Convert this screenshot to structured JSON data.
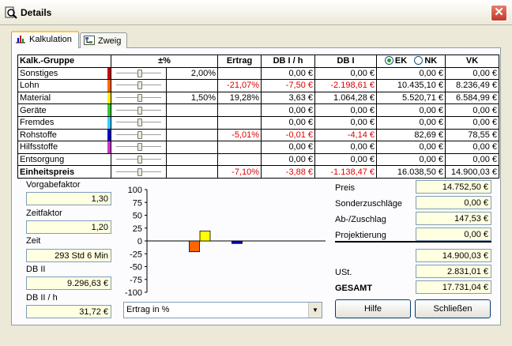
{
  "window": {
    "title": "Details",
    "close_glyph": "✕"
  },
  "tabs": [
    {
      "label": "Kalkulation",
      "icon": "chart-icon",
      "active": true
    },
    {
      "label": "Zweig",
      "icon": "tree-icon",
      "active": false
    }
  ],
  "table": {
    "headers": {
      "group": "Kalk.-Gruppe",
      "pct": "±%",
      "ertrag": "Ertrag",
      "db1h": "DB I / h",
      "db1": "DB I",
      "ek": "EK",
      "nk": "NK",
      "vk": "VK"
    },
    "price_mode_selected": "EK",
    "rows": [
      {
        "name": "Sonstiges",
        "color": "#CC0000",
        "pct": "2,00%",
        "ertrag": "",
        "db1h": "0,00 €",
        "db1": "0,00 €",
        "ek": "0,00 €",
        "vk": "0,00 €",
        "neg": false
      },
      {
        "name": "Lohn",
        "color": "#FF6600",
        "pct": "",
        "ertrag": "-21,07%",
        "db1h": "-7,50 €",
        "db1": "-2.198,61 €",
        "ek": "10.435,10 €",
        "vk": "8.236,49 €",
        "neg": true
      },
      {
        "name": "Material",
        "color": "#FFEE00",
        "pct": "1,50%",
        "ertrag": "19,28%",
        "db1h": "3,63 €",
        "db1": "1.064,28 €",
        "ek": "5.520,71 €",
        "vk": "6.584,99 €",
        "neg": false
      },
      {
        "name": "Geräte",
        "color": "#33CC33",
        "pct": "",
        "ertrag": "",
        "db1h": "0,00 €",
        "db1": "0,00 €",
        "ek": "0,00 €",
        "vk": "0,00 €",
        "neg": false
      },
      {
        "name": "Fremdes",
        "color": "#33CCFF",
        "pct": "",
        "ertrag": "",
        "db1h": "0,00 €",
        "db1": "0,00 €",
        "ek": "0,00 €",
        "vk": "0,00 €",
        "neg": false
      },
      {
        "name": "Rohstoffe",
        "color": "#0000CC",
        "pct": "",
        "ertrag": "-5,01%",
        "db1h": "-0,01 €",
        "db1": "-4,14 €",
        "ek": "82,69 €",
        "vk": "78,55 €",
        "neg": true
      },
      {
        "name": "Hilfsstoffe",
        "color": "#CC33CC",
        "pct": "",
        "ertrag": "",
        "db1h": "0,00 €",
        "db1": "0,00 €",
        "ek": "0,00 €",
        "vk": "0,00 €",
        "neg": false
      },
      {
        "name": "Entsorgung",
        "color": "#FFFFFF",
        "pct": "",
        "ertrag": "",
        "db1h": "0,00 €",
        "db1": "0,00 €",
        "ek": "0,00 €",
        "vk": "0,00 €",
        "neg": false
      },
      {
        "name": "Einheitspreis",
        "color": "#FFFFFF",
        "pct": "",
        "ertrag": "-7,10%",
        "db1h": "-3,88 €",
        "db1": "-1.138,47 €",
        "ek": "16.038,50 €",
        "vk": "14.900,03 €",
        "neg": true,
        "bold": true
      }
    ]
  },
  "left_fields": {
    "vorgabefaktor": {
      "label": "Vorgabefaktor",
      "value": "1,30"
    },
    "zeitfaktor": {
      "label": "Zeitfaktor",
      "value": "1,20"
    },
    "zeit": {
      "label": "Zeit",
      "value": "293 Std 6 Min"
    },
    "db2": {
      "label": "DB II",
      "value": "9.296,63 €"
    },
    "db2h": {
      "label": "DB II / h",
      "value": "31,72 €"
    }
  },
  "chart_data": {
    "type": "bar",
    "title": "",
    "xlabel": "",
    "ylabel": "",
    "ylim": [
      -100,
      100
    ],
    "yticks": [
      100,
      75,
      50,
      25,
      0,
      -25,
      -50,
      -75,
      -100
    ],
    "categories": [
      "Sonstiges",
      "Lohn",
      "Material",
      "Geräte",
      "Fremdes",
      "Rohstoffe",
      "Hilfsstoffe",
      "Entsorgung"
    ],
    "values": [
      0,
      -21.07,
      19.28,
      0,
      0,
      -5.01,
      0,
      0
    ],
    "colors": [
      "#CC0000",
      "#FF6600",
      "#FFFF00",
      "#33CC33",
      "#33CCFF",
      "#0000CC",
      "#CC33CC",
      "#FFFFFF"
    ],
    "grid": false
  },
  "chart_select": {
    "value": "Ertrag in %"
  },
  "summary": {
    "preis": {
      "label": "Preis",
      "value": "14.752,50 €"
    },
    "sonder": {
      "label": "Sonderzuschläge",
      "value": "0,00 €"
    },
    "abzu": {
      "label": "Ab-/Zuschlag",
      "value": "147,53 €"
    },
    "projekt": {
      "label": "Projektierung",
      "value": "0,00 €"
    },
    "netto": {
      "value": "14.900,03 €"
    },
    "ust": {
      "label": "USt.",
      "value": "2.831,01 €"
    },
    "gesamt": {
      "label": "GESAMT",
      "value": "17.731,04 €"
    }
  },
  "buttons": {
    "help": "Hilfe",
    "close": "Schließen"
  }
}
